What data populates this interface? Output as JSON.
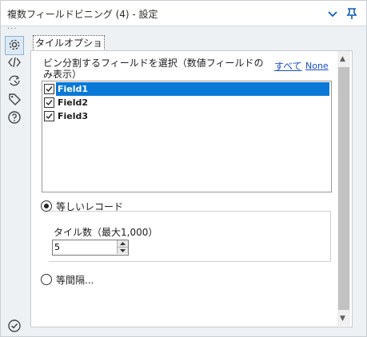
{
  "window": {
    "title": "複数フィールドビニング (4) - 設定"
  },
  "tab": {
    "label": "タイルオプション"
  },
  "fields": {
    "select_label": "ビン分割するフィールドを選択（数値フィールドのみ表示）",
    "all_link": "すべて",
    "none_link": "None",
    "items": [
      {
        "label": "Field1",
        "checked": true,
        "selected": true
      },
      {
        "label": "Field2",
        "checked": true,
        "selected": false
      },
      {
        "label": "Field3",
        "checked": true,
        "selected": false
      }
    ]
  },
  "method": {
    "equal_records_label": "等しいレコード",
    "tile_count_label": "タイル数（最大1,000）",
    "tile_count_value": "5",
    "equal_interval_label": "等間隔..."
  },
  "colors": {
    "selection": "#0a78d7",
    "link": "#1a4fcc"
  }
}
